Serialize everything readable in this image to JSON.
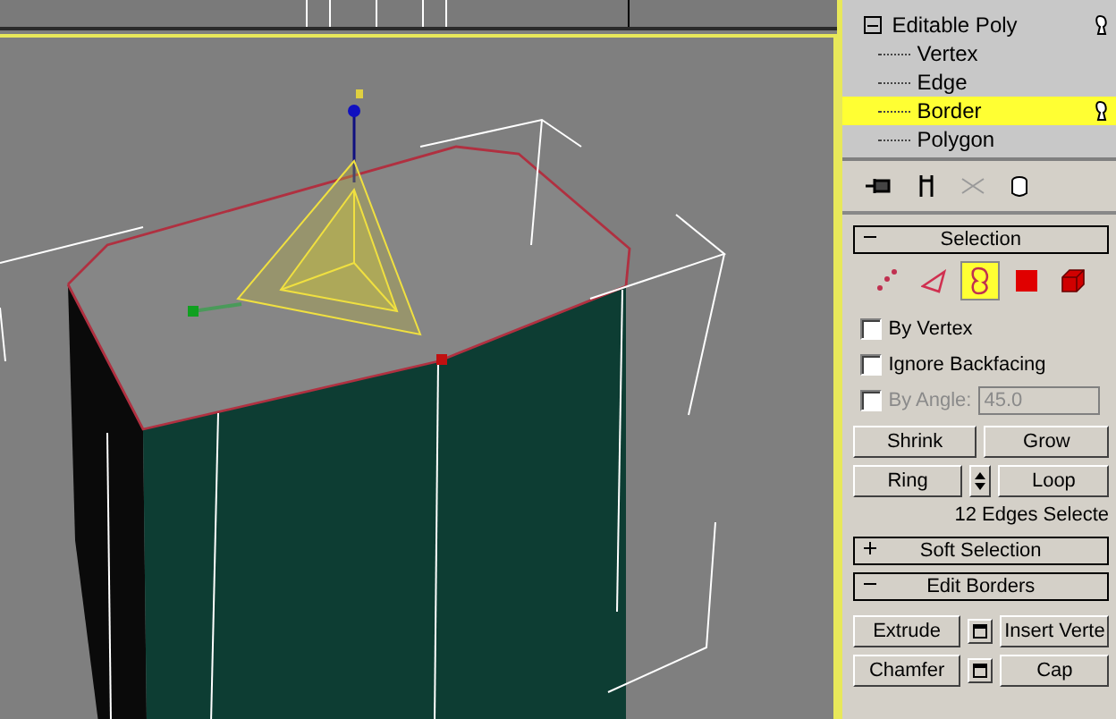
{
  "stack": {
    "items": [
      {
        "label": "Editable Poly",
        "expanded": true,
        "children": [
          {
            "label": "Vertex",
            "selected": false
          },
          {
            "label": "Edge",
            "selected": false
          },
          {
            "label": "Border",
            "selected": true
          },
          {
            "label": "Polygon",
            "selected": false
          }
        ]
      }
    ]
  },
  "selection": {
    "title": "Selection",
    "expanded": true,
    "subobjects": [
      {
        "kind": "vertex",
        "selected": false
      },
      {
        "kind": "edge",
        "selected": false
      },
      {
        "kind": "border",
        "selected": true
      },
      {
        "kind": "polygon",
        "selected": false
      },
      {
        "kind": "element",
        "selected": false
      }
    ],
    "options": [
      {
        "label": "By Vertex",
        "checked": false,
        "disabled": false
      },
      {
        "label": "Ignore Backfacing",
        "checked": false,
        "disabled": false
      }
    ],
    "angle": {
      "label": "By Angle:",
      "value": "45.0",
      "checked": false,
      "disabled": true
    },
    "grow_row": [
      "Shrink",
      "Grow"
    ],
    "ring_row": [
      "Ring",
      "Loop"
    ],
    "status": "12 Edges Selecte"
  },
  "soft_selection": {
    "title": "Soft Selection",
    "expanded": false
  },
  "edit_borders": {
    "title": "Edit Borders",
    "expanded": true,
    "rows": [
      [
        "Extrude",
        "Insert Verte"
      ],
      [
        "Chamfer",
        "Cap"
      ]
    ]
  }
}
